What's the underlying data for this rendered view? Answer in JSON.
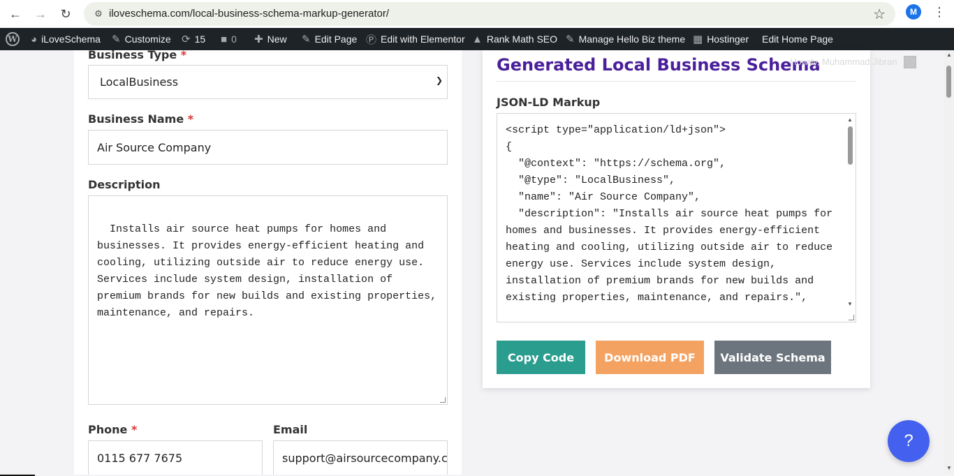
{
  "browser": {
    "url": "iloveschema.com/local-business-schema-markup-generator/",
    "profile_initial": "M"
  },
  "adminbar": {
    "site_name": "iLoveSchema",
    "customize": "Customize",
    "updates_count": "15",
    "comments_count": "0",
    "new": "New",
    "edit_page": "Edit Page",
    "edit_elementor": "Edit with Elementor",
    "rank_math": "Rank Math SEO",
    "manage_theme": "Manage Hello Biz theme",
    "hostinger": "Hostinger",
    "edit_home": "Edit Home Page"
  },
  "form": {
    "business_type_label": "Business Type",
    "business_type_value": "LocalBusiness",
    "business_name_label": "Business Name",
    "business_name_value": "Air Source Company",
    "description_label": "Description",
    "description_value": "Installs air source heat pumps for homes and businesses. It provides energy-efficient heating and cooling, utilizing outside air to reduce energy use. Services include system design, installation of premium brands for new builds and existing properties, maintenance, and repairs.",
    "phone_label": "Phone",
    "phone_value": "0115 677 7675",
    "email_label": "Email",
    "email_value": "support@airsourcecompany.cor",
    "required_mark": "*"
  },
  "output": {
    "title": "Generated Local Business Schema",
    "howdy": "Howdy, Muhammad Jibran",
    "jsonld_label": "JSON-LD Markup",
    "code": "<script type=\"application/ld+json\">\n{\n  \"@context\": \"https://schema.org\",\n  \"@type\": \"LocalBusiness\",\n  \"name\": \"Air Source Company\",\n  \"description\": \"Installs air source heat pumps for homes and businesses. It provides energy-efficient heating and cooling, utilizing outside air to reduce energy use. Services include system design, installation of premium brands for new builds and existing properties, maintenance, and repairs.\",",
    "copy_label": "Copy Code",
    "pdf_label": "Download PDF",
    "validate_label": "Validate Schema"
  },
  "help": {
    "label": "?"
  },
  "colors": {
    "title": "#4a1f9a",
    "copy": "#2a9d8f",
    "pdf": "#f4a261",
    "validate": "#6c757d",
    "help": "#4361ee",
    "adminbar": "#1d2327"
  }
}
